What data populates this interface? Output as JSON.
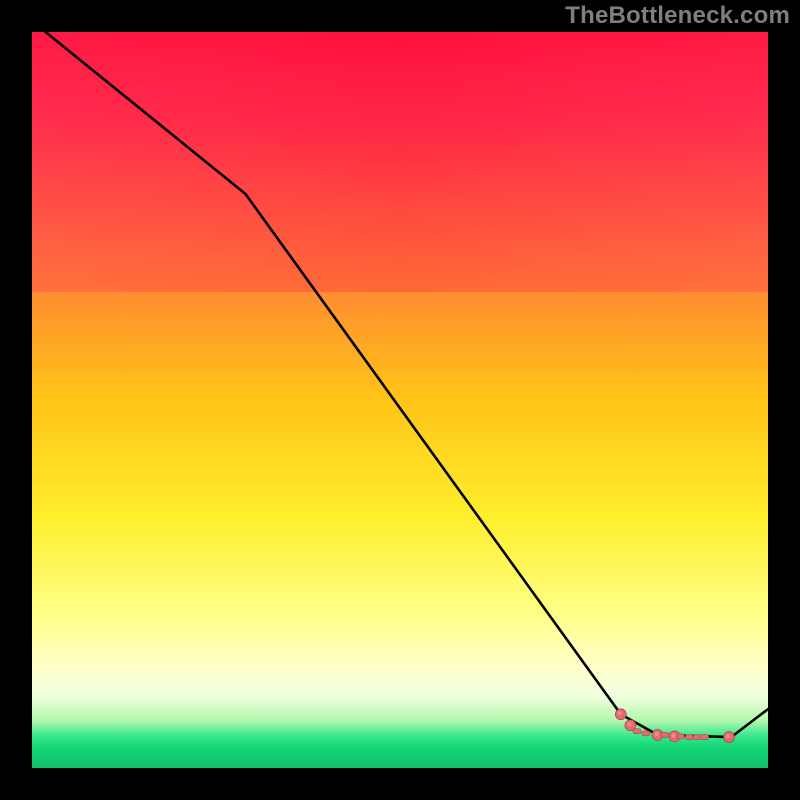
{
  "watermark": "TheBottleneck.com",
  "colors": {
    "bg": "#000000",
    "grad_top_center": "#ff0e3c",
    "grad_top_side": "#ff2857",
    "grad_mid": "#ffd400",
    "grad_low": "#ffff9a",
    "grad_green": "#1ee37a",
    "line": "#000000",
    "marker_fill": "#e46a6e",
    "marker_stroke_light": "#f2a6a8",
    "marker_stroke_dark": "#9c3e42"
  },
  "chart_data": {
    "type": "line",
    "title": "",
    "xlabel": "",
    "ylabel": "",
    "xlim": [
      0,
      100
    ],
    "ylim": [
      0,
      100
    ],
    "grid": false,
    "legend": false,
    "comment": "Axes are unlabeled in the image; values below are read off the 736x736 plot area in percent of each axis (0 at left/bottom, 100 at right/top).",
    "series": [
      {
        "name": "curve",
        "style": "solid-black",
        "x": [
          0,
          29,
          80,
          85,
          95,
          100
        ],
        "y": [
          101.5,
          78,
          7.3,
          4.5,
          4.2,
          8.0
        ]
      },
      {
        "name": "markers",
        "style": "red-dots-and-dashes",
        "points": [
          {
            "x": 80.0,
            "y": 7.3,
            "kind": "dot"
          },
          {
            "x": 81.3,
            "y": 5.8,
            "kind": "dot"
          },
          {
            "x": 82.2,
            "y": 5.0,
            "kind": "dash"
          },
          {
            "x": 83.4,
            "y": 4.7,
            "kind": "dash"
          },
          {
            "x": 85.0,
            "y": 4.5,
            "kind": "dot"
          },
          {
            "x": 86.0,
            "y": 4.5,
            "kind": "dash"
          },
          {
            "x": 87.3,
            "y": 4.3,
            "kind": "dot"
          },
          {
            "x": 88.1,
            "y": 4.3,
            "kind": "dash"
          },
          {
            "x": 89.3,
            "y": 4.2,
            "kind": "dash"
          },
          {
            "x": 90.4,
            "y": 4.2,
            "kind": "dash"
          },
          {
            "x": 91.4,
            "y": 4.2,
            "kind": "dash"
          },
          {
            "x": 94.7,
            "y": 4.2,
            "kind": "dot"
          }
        ]
      }
    ]
  }
}
